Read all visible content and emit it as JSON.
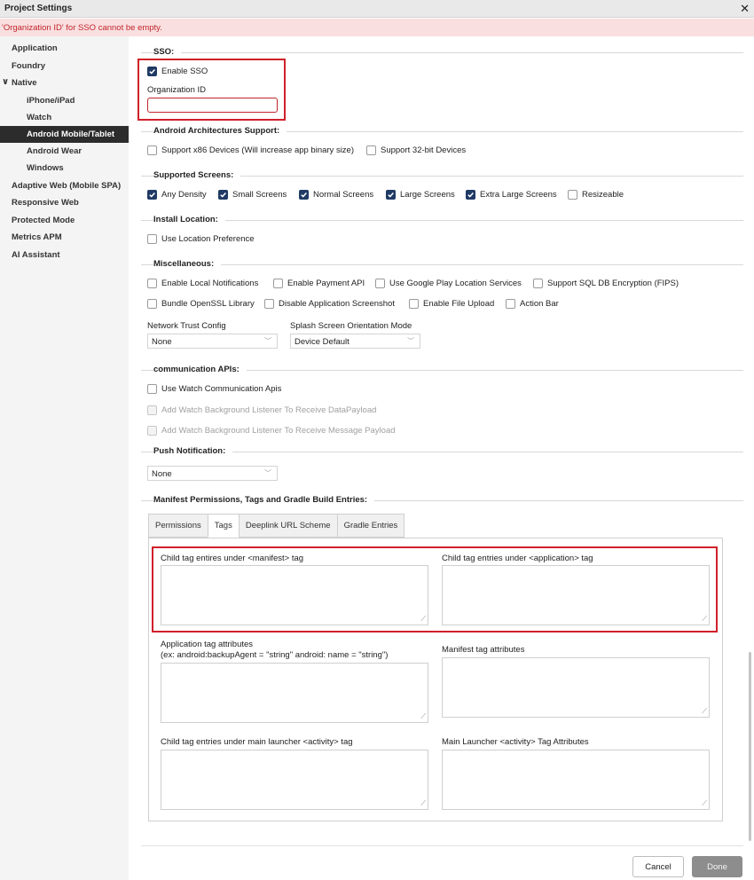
{
  "window": {
    "title": "Project Settings",
    "close_glyph": "✕"
  },
  "error": {
    "message": "'Organization ID' for SSO cannot be empty."
  },
  "sidebar": {
    "items": [
      {
        "label": "Application"
      },
      {
        "label": "Foundry"
      },
      {
        "label": "Native"
      },
      {
        "label": "iPhone/iPad"
      },
      {
        "label": "Watch"
      },
      {
        "label": "Android Mobile/Tablet"
      },
      {
        "label": "Android Wear"
      },
      {
        "label": "Windows"
      },
      {
        "label": "Adaptive Web (Mobile SPA)"
      },
      {
        "label": "Responsive Web"
      },
      {
        "label": "Protected Mode"
      },
      {
        "label": "Metrics APM"
      },
      {
        "label": "AI Assistant"
      }
    ],
    "active": "Android Mobile/Tablet",
    "expanded_chevron": "∨"
  },
  "sso": {
    "heading": "SSO:",
    "enable_label": "Enable SSO",
    "enable_checked": true,
    "org_label": "Organization ID",
    "org_value": ""
  },
  "arch": {
    "heading": "Android Architectures Support:",
    "x86": "Support x86 Devices (Will increase app binary size)",
    "bit32": "Support 32-bit Devices"
  },
  "screens": {
    "heading": "Supported Screens:",
    "any": "Any Density",
    "small": "Small Screens",
    "normal": "Normal Screens",
    "large": "Large Screens",
    "xlarge": "Extra Large Screens",
    "resizeable": "Resizeable"
  },
  "install": {
    "heading": "Install Location:",
    "use_pref": "Use Location Preference"
  },
  "misc": {
    "heading": "Miscellaneous:",
    "local_notif": "Enable Local Notifications",
    "payment": "Enable Payment API",
    "gplay_loc": "Use Google Play Location Services",
    "sqldb": "Support SQL DB Encryption (FIPS)",
    "openssl": "Bundle OpenSSL Library",
    "disable_ss": "Disable Application Screenshot",
    "file_upload": "Enable File Upload",
    "action_bar": "Action Bar",
    "ntc_label": "Network Trust Config",
    "ntc_value": "None",
    "splash_label": "Splash Screen Orientation Mode",
    "splash_value": "Device Default"
  },
  "comm": {
    "heading": "communication APIs:",
    "watch_apis": "Use Watch Communication Apis",
    "bg_data": "Add Watch Background Listener To Receive DataPayload",
    "bg_msg": "Add Watch Background Listener To Receive Message Payload"
  },
  "push": {
    "heading": "Push Notification:",
    "value": "None"
  },
  "manifest": {
    "heading": "Manifest Permissions, Tags and Gradle Build Entries:",
    "tabs": [
      {
        "label": "Permissions"
      },
      {
        "label": "Tags"
      },
      {
        "label": "Deeplink URL Scheme"
      },
      {
        "label": "Gradle Entries"
      }
    ],
    "child_manifest": "Child tag entires under <manifest> tag",
    "child_application": "Child tag entries under <application> tag",
    "app_attrs": "Application tag attributes",
    "app_attrs_hint": "(ex: android:backupAgent = \"string\" android: name = \"string\")",
    "manifest_attrs": "Manifest tag attributes",
    "child_activity": "Child tag entries under main launcher <activity> tag",
    "activity_attrs": "Main Launcher <activity> Tag Attributes"
  },
  "footer": {
    "cancel": "Cancel",
    "done": "Done"
  },
  "icons": {
    "check": "checkmark-icon",
    "caret": "chevron-down-icon",
    "resize": "resize-grip-icon"
  },
  "colors": {
    "accent": "#1f3a64",
    "error_text": "#c0262c",
    "error_bg": "#f9dfe0",
    "highlight": "#d0202a",
    "active_nav": "#2c2c2c"
  }
}
